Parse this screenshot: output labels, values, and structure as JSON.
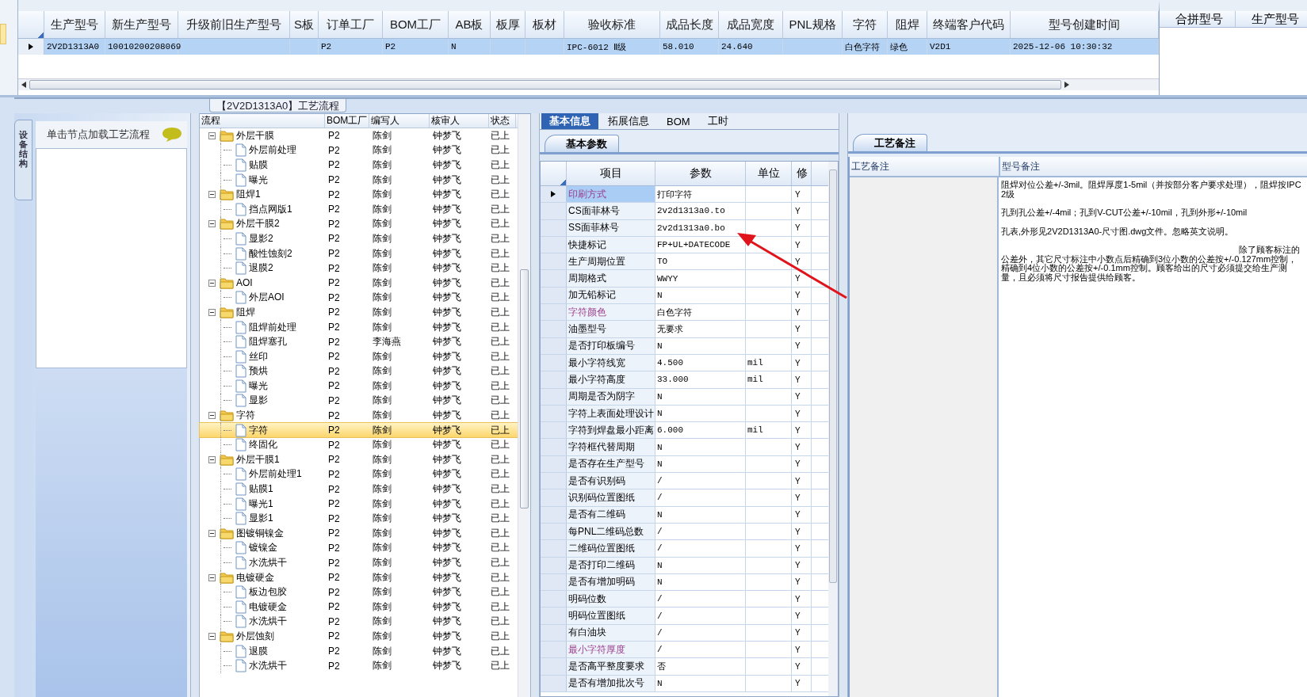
{
  "main_grid": {
    "columns": [
      "生产型号",
      "新生产型号",
      "升级前旧生产型号",
      "S板",
      "订单工厂",
      "BOM工厂",
      "AB板",
      "板厚",
      "板材",
      "验收标准",
      "成品长度",
      "成品宽度",
      "PNL规格",
      "字符",
      "阻焊",
      "终端客户代码",
      "型号创建时间"
    ],
    "rows": [
      {
        "selected": true,
        "cells": [
          "2V2D1313A0",
          "10010200208069",
          "",
          "",
          "P2",
          "P2",
          "N",
          "",
          "",
          "IPC-6012 Ⅱ级",
          "58.010",
          "24.640",
          "",
          "白色字符",
          "绿色",
          "V2D1",
          "2025-12-06 10:30:32"
        ]
      }
    ]
  },
  "merge_grid": {
    "columns": [
      "合拼型号",
      "生产型号"
    ]
  },
  "side_panel": {
    "vertical_tab": "设备结构",
    "header": "单击节点加载工艺流程"
  },
  "flow": {
    "title": "【2V2D1313A0】工艺流程",
    "columns": [
      "流程",
      "BOM工厂",
      "编写人",
      "核审人",
      "状态"
    ],
    "nodes": [
      {
        "name": "外层干膜",
        "bom": "P2",
        "writer": "陈剑",
        "reviewer": "钟梦飞",
        "status": "已上",
        "selected": false,
        "expanded": true,
        "children": [
          {
            "name": "外层前处理",
            "bom": "P2",
            "writer": "陈剑",
            "reviewer": "钟梦飞",
            "status": "已上",
            "selected": false
          },
          {
            "name": "贴膜",
            "bom": "P2",
            "writer": "陈剑",
            "reviewer": "钟梦飞",
            "status": "已上",
            "selected": false
          },
          {
            "name": "曝光",
            "bom": "P2",
            "writer": "陈剑",
            "reviewer": "钟梦飞",
            "status": "已上",
            "selected": false
          }
        ]
      },
      {
        "name": "阻焊1",
        "bom": "P2",
        "writer": "陈剑",
        "reviewer": "钟梦飞",
        "status": "已上",
        "selected": false,
        "expanded": true,
        "children": [
          {
            "name": "挡点网版1",
            "bom": "P2",
            "writer": "陈剑",
            "reviewer": "钟梦飞",
            "status": "已上",
            "selected": false
          }
        ]
      },
      {
        "name": "外层干膜2",
        "bom": "P2",
        "writer": "陈剑",
        "reviewer": "钟梦飞",
        "status": "已上",
        "selected": false,
        "expanded": true,
        "children": [
          {
            "name": "显影2",
            "bom": "P2",
            "writer": "陈剑",
            "reviewer": "钟梦飞",
            "status": "已上",
            "selected": false
          },
          {
            "name": "酸性蚀刻2",
            "bom": "P2",
            "writer": "陈剑",
            "reviewer": "钟梦飞",
            "status": "已上",
            "selected": false
          },
          {
            "name": "退膜2",
            "bom": "P2",
            "writer": "陈剑",
            "reviewer": "钟梦飞",
            "status": "已上",
            "selected": false
          }
        ]
      },
      {
        "name": "AOI",
        "bom": "P2",
        "writer": "陈剑",
        "reviewer": "钟梦飞",
        "status": "已上",
        "selected": false,
        "expanded": true,
        "children": [
          {
            "name": "外层AOI",
            "bom": "P2",
            "writer": "陈剑",
            "reviewer": "钟梦飞",
            "status": "已上",
            "selected": false
          }
        ]
      },
      {
        "name": "阻焊",
        "bom": "P2",
        "writer": "陈剑",
        "reviewer": "钟梦飞",
        "status": "已上",
        "selected": false,
        "expanded": true,
        "children": [
          {
            "name": "阻焊前处理",
            "bom": "P2",
            "writer": "陈剑",
            "reviewer": "钟梦飞",
            "status": "已上",
            "selected": false
          },
          {
            "name": "阻焊塞孔",
            "bom": "P2",
            "writer": "李海燕",
            "reviewer": "钟梦飞",
            "status": "已上",
            "selected": false
          },
          {
            "name": "丝印",
            "bom": "P2",
            "writer": "陈剑",
            "reviewer": "钟梦飞",
            "status": "已上",
            "selected": false
          },
          {
            "name": "预烘",
            "bom": "P2",
            "writer": "陈剑",
            "reviewer": "钟梦飞",
            "status": "已上",
            "selected": false
          },
          {
            "name": "曝光",
            "bom": "P2",
            "writer": "陈剑",
            "reviewer": "钟梦飞",
            "status": "已上",
            "selected": false
          },
          {
            "name": "显影",
            "bom": "P2",
            "writer": "陈剑",
            "reviewer": "钟梦飞",
            "status": "已上",
            "selected": false
          }
        ]
      },
      {
        "name": "字符",
        "bom": "P2",
        "writer": "陈剑",
        "reviewer": "钟梦飞",
        "status": "已上",
        "selected": false,
        "expanded": true,
        "children": [
          {
            "name": "字符",
            "bom": "P2",
            "writer": "陈剑",
            "reviewer": "钟梦飞",
            "status": "已上",
            "selected": true
          },
          {
            "name": "终固化",
            "bom": "P2",
            "writer": "陈剑",
            "reviewer": "钟梦飞",
            "status": "已上",
            "selected": false
          }
        ]
      },
      {
        "name": "外层干膜1",
        "bom": "P2",
        "writer": "陈剑",
        "reviewer": "钟梦飞",
        "status": "已上",
        "selected": false,
        "expanded": true,
        "children": [
          {
            "name": "外层前处理1",
            "bom": "P2",
            "writer": "陈剑",
            "reviewer": "钟梦飞",
            "status": "已上",
            "selected": false
          },
          {
            "name": "贴膜1",
            "bom": "P2",
            "writer": "陈剑",
            "reviewer": "钟梦飞",
            "status": "已上",
            "selected": false
          },
          {
            "name": "曝光1",
            "bom": "P2",
            "writer": "陈剑",
            "reviewer": "钟梦飞",
            "status": "已上",
            "selected": false
          },
          {
            "name": "显影1",
            "bom": "P2",
            "writer": "陈剑",
            "reviewer": "钟梦飞",
            "status": "已上",
            "selected": false
          }
        ]
      },
      {
        "name": "图镀铜镍金",
        "bom": "P2",
        "writer": "陈剑",
        "reviewer": "钟梦飞",
        "status": "已上",
        "selected": false,
        "expanded": true,
        "children": [
          {
            "name": "镀镍金",
            "bom": "P2",
            "writer": "陈剑",
            "reviewer": "钟梦飞",
            "status": "已上",
            "selected": false
          },
          {
            "name": "水洗烘干",
            "bom": "P2",
            "writer": "陈剑",
            "reviewer": "钟梦飞",
            "status": "已上",
            "selected": false
          }
        ]
      },
      {
        "name": "电镀硬金",
        "bom": "P2",
        "writer": "陈剑",
        "reviewer": "钟梦飞",
        "status": "已上",
        "selected": false,
        "expanded": true,
        "children": [
          {
            "name": "板边包胶",
            "bom": "P2",
            "writer": "陈剑",
            "reviewer": "钟梦飞",
            "status": "已上",
            "selected": false
          },
          {
            "name": "电镀硬金",
            "bom": "P2",
            "writer": "陈剑",
            "reviewer": "钟梦飞",
            "status": "已上",
            "selected": false
          },
          {
            "name": "水洗烘干",
            "bom": "P2",
            "writer": "陈剑",
            "reviewer": "钟梦飞",
            "status": "已上",
            "selected": false
          }
        ]
      },
      {
        "name": "外层蚀刻",
        "bom": "P2",
        "writer": "陈剑",
        "reviewer": "钟梦飞",
        "status": "已上",
        "selected": false,
        "expanded": true,
        "children": [
          {
            "name": "退膜",
            "bom": "P2",
            "writer": "陈剑",
            "reviewer": "钟梦飞",
            "status": "已上",
            "selected": false
          },
          {
            "name": "水洗烘干",
            "bom": "P2",
            "writer": "陈剑",
            "reviewer": "钟梦飞",
            "status": "已上",
            "selected": false
          }
        ]
      }
    ]
  },
  "info_tabs": [
    {
      "label": "基本信息",
      "selected": true
    },
    {
      "label": "拓展信息",
      "selected": false
    },
    {
      "label": "BOM",
      "selected": false
    },
    {
      "label": "工时",
      "selected": false
    }
  ],
  "params": {
    "tab": "基本参数",
    "columns": [
      "项目",
      "参数",
      "单位",
      "修"
    ],
    "rows": [
      {
        "item": "印刷方式",
        "value": "打印字符",
        "unit": "",
        "mod": "Y",
        "flagged": true,
        "selected": true
      },
      {
        "item": "CS面菲林号",
        "value": "2v2d1313a0.to",
        "unit": "",
        "mod": "Y",
        "flagged": false,
        "selected": false
      },
      {
        "item": "SS面菲林号",
        "value": "2v2d1313a0.bo",
        "unit": "",
        "mod": "Y",
        "flagged": false,
        "selected": false
      },
      {
        "item": "快捷标记",
        "value": "FP+UL+DATECODE",
        "unit": "",
        "mod": "Y",
        "flagged": false,
        "selected": false
      },
      {
        "item": "生产周期位置",
        "value": "TO",
        "unit": "",
        "mod": "Y",
        "flagged": false,
        "selected": false
      },
      {
        "item": "周期格式",
        "value": "WWYY",
        "unit": "",
        "mod": "Y",
        "flagged": false,
        "selected": false
      },
      {
        "item": "加无铅标记",
        "value": "N",
        "unit": "",
        "mod": "Y",
        "flagged": false,
        "selected": false
      },
      {
        "item": "字符颜色",
        "value": "白色字符",
        "unit": "",
        "mod": "Y",
        "flagged": true,
        "selected": false
      },
      {
        "item": "油墨型号",
        "value": "无要求",
        "unit": "",
        "mod": "Y",
        "flagged": false,
        "selected": false
      },
      {
        "item": "是否打印板编号",
        "value": "N",
        "unit": "",
        "mod": "Y",
        "flagged": false,
        "selected": false
      },
      {
        "item": "最小字符线宽",
        "value": "4.500",
        "unit": "mil",
        "mod": "Y",
        "flagged": false,
        "selected": false
      },
      {
        "item": "最小字符高度",
        "value": "33.000",
        "unit": "mil",
        "mod": "Y",
        "flagged": false,
        "selected": false
      },
      {
        "item": "周期是否为阴字",
        "value": "N",
        "unit": "",
        "mod": "Y",
        "flagged": false,
        "selected": false
      },
      {
        "item": "字符上表面处理设计",
        "value": "N",
        "unit": "",
        "mod": "Y",
        "flagged": false,
        "selected": false
      },
      {
        "item": "字符到焊盘最小距离",
        "value": "6.000",
        "unit": "mil",
        "mod": "Y",
        "flagged": false,
        "selected": false
      },
      {
        "item": "字符框代替周期",
        "value": "N",
        "unit": "",
        "mod": "Y",
        "flagged": false,
        "selected": false
      },
      {
        "item": "是否存在生产型号",
        "value": "N",
        "unit": "",
        "mod": "Y",
        "flagged": false,
        "selected": false
      },
      {
        "item": "是否有识别码",
        "value": "/",
        "unit": "",
        "mod": "Y",
        "flagged": false,
        "selected": false
      },
      {
        "item": "识别码位置图纸",
        "value": "/",
        "unit": "",
        "mod": "Y",
        "flagged": false,
        "selected": false
      },
      {
        "item": "是否有二维码",
        "value": "N",
        "unit": "",
        "mod": "Y",
        "flagged": false,
        "selected": false
      },
      {
        "item": "每PNL二维码总数",
        "value": "/",
        "unit": "",
        "mod": "Y",
        "flagged": false,
        "selected": false
      },
      {
        "item": "二维码位置图纸",
        "value": "/",
        "unit": "",
        "mod": "Y",
        "flagged": false,
        "selected": false
      },
      {
        "item": "是否打印二维码",
        "value": "N",
        "unit": "",
        "mod": "Y",
        "flagged": false,
        "selected": false
      },
      {
        "item": "是否有增加明码",
        "value": "N",
        "unit": "",
        "mod": "Y",
        "flagged": false,
        "selected": false
      },
      {
        "item": "明码位数",
        "value": "/",
        "unit": "",
        "mod": "Y",
        "flagged": false,
        "selected": false
      },
      {
        "item": "明码位置图纸",
        "value": "/",
        "unit": "",
        "mod": "Y",
        "flagged": false,
        "selected": false
      },
      {
        "item": "有白油块",
        "value": "/",
        "unit": "",
        "mod": "Y",
        "flagged": false,
        "selected": false
      },
      {
        "item": "最小字符厚度",
        "value": "/",
        "unit": "",
        "mod": "Y",
        "flagged": true,
        "selected": false
      },
      {
        "item": "是否高平整度要求",
        "value": "否",
        "unit": "",
        "mod": "Y",
        "flagged": false,
        "selected": false
      },
      {
        "item": "是否有增加批次号",
        "value": "N",
        "unit": "",
        "mod": "Y",
        "flagged": false,
        "selected": false
      }
    ]
  },
  "remarks": {
    "tab": "工艺备注",
    "columns": [
      "工艺备注",
      "型号备注"
    ],
    "paragraphs": [
      {
        "text": "阻焊对位公差+/-3mil。阻焊厚度1-5mil（并按部分客户要求处理），阻焊按IPC 2级",
        "indent": false
      },
      {
        "text": "孔到孔公差+/-4mil；孔到V-CUT公差+/-10mil，孔到外形+/-10mil",
        "indent": false
      },
      {
        "text": "孔表,外形见2V2D1313A0-尺寸图.dwg文件。忽略英文说明。",
        "indent": false
      },
      {
        "text": "除了顾客标注的公差外，其它尺寸标注中小数点后精确到3位小数的公差按+/-0.127mm控制，精确到4位小数的公差按+/-0.1mm控制。顾客给出的尺寸必须提交给生产测量，且必须将尺寸报告提供给顾客。",
        "indent": true
      }
    ]
  }
}
